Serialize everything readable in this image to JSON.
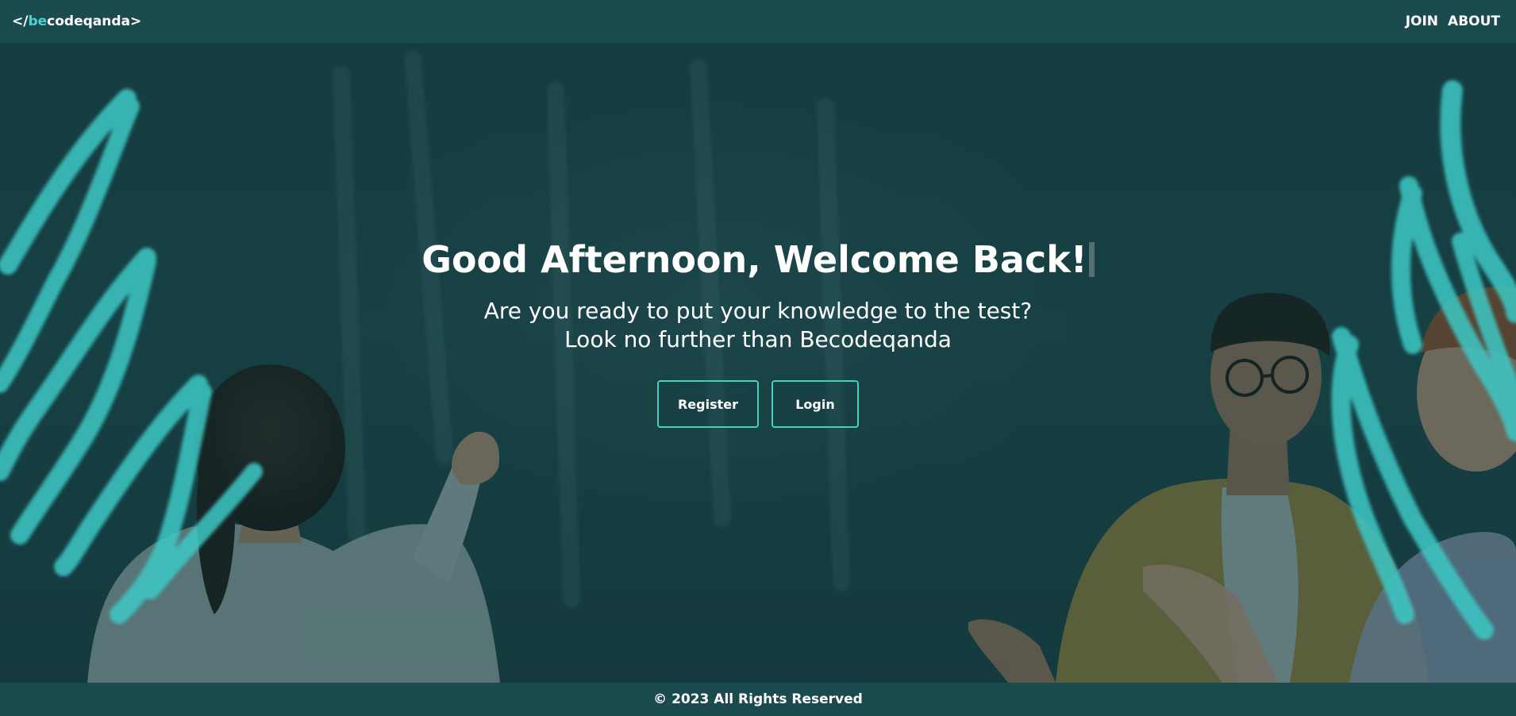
{
  "header": {
    "logo_prefix": "</",
    "logo_accent": "be",
    "logo_suffix": "codeqanda>",
    "nav": [
      {
        "label": "JOIN"
      },
      {
        "label": "ABOUT"
      }
    ]
  },
  "hero": {
    "headline": "Good Afternoon, Welcome Back!",
    "subline_1": "Are you ready to put your knowledge to the test?",
    "subline_2": "Look no further than Becodeqanda",
    "register_label": "Register",
    "login_label": "Login"
  },
  "footer": {
    "copyright": "© 2023 All Rights Reserved"
  },
  "colors": {
    "header_bg": "#1b4b4f",
    "accent": "#4fd1d0",
    "button_border": "#3fd3c4"
  }
}
